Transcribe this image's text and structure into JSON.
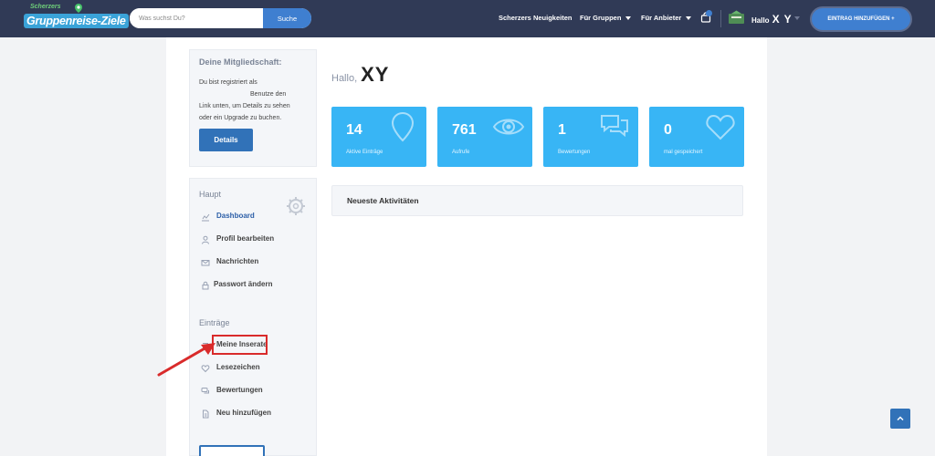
{
  "header": {
    "logo_small": "Scherzers",
    "logo_main": "Gruppenreise-Ziele",
    "search": {
      "placeholder": "Was suchst Du?",
      "button_label": "Suche"
    },
    "nav": [
      {
        "label": "Scherzers Neuigkeiten",
        "has_dropdown": false
      },
      {
        "label": "Für Gruppen",
        "has_dropdown": true
      },
      {
        "label": "Für Anbieter",
        "has_dropdown": true
      }
    ],
    "cart_icon": "bag-icon",
    "user": {
      "greeting": "Hallo",
      "name": "X Y"
    },
    "add_entry_label": "EINTRAG HINZUFÜGEN +"
  },
  "membership": {
    "title": "Deine Mitgliedschaft:",
    "text_line1": "Du bist registriert als",
    "text_line2": "Benutze den",
    "text_line3": "Link unten, um Details zu sehen",
    "text_line4": "oder ein Upgrade zu buchen.",
    "details_label": "Details"
  },
  "sidebar": {
    "main_heading": "Haupt",
    "main_items": [
      {
        "label": "Dashboard",
        "icon": "chart-icon",
        "active": true
      },
      {
        "label": "Profil bearbeiten",
        "icon": "user-icon",
        "active": false
      },
      {
        "label": "Nachrichten",
        "icon": "envelope-icon",
        "active": false
      },
      {
        "label": "Passwort ändern",
        "icon": "lock-icon",
        "active": false
      }
    ],
    "entries_heading": "Einträge",
    "entries_items": [
      {
        "label": "Meine Inserate",
        "icon": "list-icon"
      },
      {
        "label": "Lesezeichen",
        "icon": "heart-icon"
      },
      {
        "label": "Bewertungen",
        "icon": "comments-icon"
      },
      {
        "label": "Neu hinzufügen",
        "icon": "file-icon"
      }
    ]
  },
  "main": {
    "greeting": "Hallo,",
    "name": "XY",
    "stats": [
      {
        "value": "14",
        "label": "Aktive Einträge",
        "icon": "map-pin-icon"
      },
      {
        "value": "761",
        "label": "Aufrufe",
        "icon": "eye-icon"
      },
      {
        "value": "1",
        "label": "Bewertungen",
        "icon": "chat-bubbles-icon"
      },
      {
        "value": "0",
        "label": "mal gespeichert",
        "icon": "heart-icon"
      }
    ],
    "activity_title": "Neueste Aktivitäten"
  },
  "colors": {
    "header_bg": "#303a56",
    "accent": "#3f7fd0",
    "stat_card": "#38b5f5",
    "highlight": "#d92b2b"
  }
}
